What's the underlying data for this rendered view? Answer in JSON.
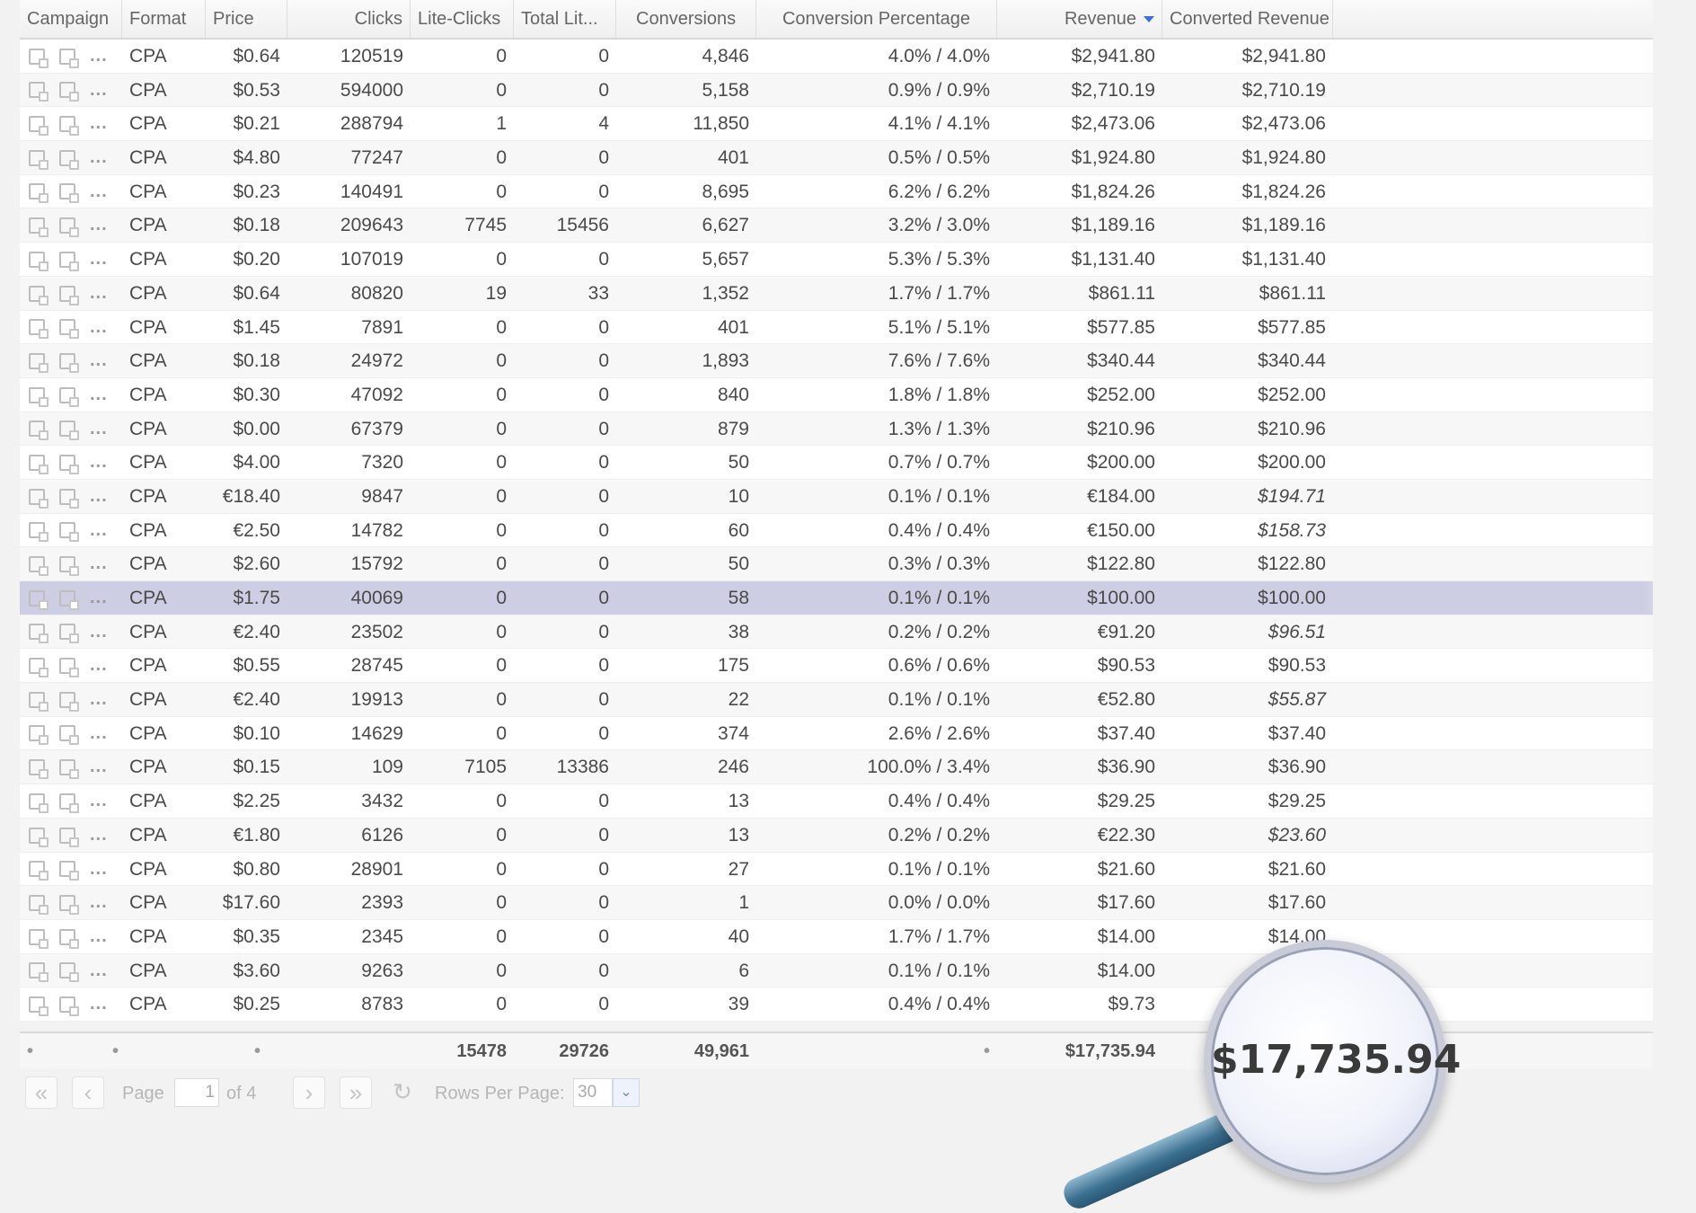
{
  "columns": {
    "campaign": "Campaign",
    "format": "Format",
    "price": "Price",
    "clicks": "Clicks",
    "lite_clicks": "Lite-Clicks",
    "total_lite": "Total Lit...",
    "conversions": "Conversions",
    "conversion_percentage": "Conversion Percentage",
    "revenue": "Revenue",
    "converted_revenue": "Converted Revenue"
  },
  "sort": {
    "column": "revenue",
    "direction": "desc",
    "indicator_color": "#3a6fd6"
  },
  "row_icons": [
    "copy-icon",
    "window-icon",
    "more-icon"
  ],
  "more_glyph": "...",
  "rows": [
    {
      "format": "CPA",
      "price": "$0.64",
      "clicks": "120519",
      "lite": "0",
      "total_lite": "0",
      "conv": "4,846",
      "pct": "4.0% / 4.0%",
      "revenue": "$2,941.80",
      "converted": "$2,941.80"
    },
    {
      "format": "CPA",
      "price": "$0.53",
      "clicks": "594000",
      "lite": "0",
      "total_lite": "0",
      "conv": "5,158",
      "pct": "0.9% / 0.9%",
      "revenue": "$2,710.19",
      "converted": "$2,710.19"
    },
    {
      "format": "CPA",
      "price": "$0.21",
      "clicks": "288794",
      "lite": "1",
      "total_lite": "4",
      "conv": "11,850",
      "pct": "4.1% / 4.1%",
      "revenue": "$2,473.06",
      "converted": "$2,473.06"
    },
    {
      "format": "CPA",
      "price": "$4.80",
      "clicks": "77247",
      "lite": "0",
      "total_lite": "0",
      "conv": "401",
      "pct": "0.5% / 0.5%",
      "revenue": "$1,924.80",
      "converted": "$1,924.80"
    },
    {
      "format": "CPA",
      "price": "$0.23",
      "clicks": "140491",
      "lite": "0",
      "total_lite": "0",
      "conv": "8,695",
      "pct": "6.2% / 6.2%",
      "revenue": "$1,824.26",
      "converted": "$1,824.26"
    },
    {
      "format": "CPA",
      "price": "$0.18",
      "clicks": "209643",
      "lite": "7745",
      "total_lite": "15456",
      "conv": "6,627",
      "pct": "3.2% / 3.0%",
      "revenue": "$1,189.16",
      "converted": "$1,189.16"
    },
    {
      "format": "CPA",
      "price": "$0.20",
      "clicks": "107019",
      "lite": "0",
      "total_lite": "0",
      "conv": "5,657",
      "pct": "5.3% / 5.3%",
      "revenue": "$1,131.40",
      "converted": "$1,131.40"
    },
    {
      "format": "CPA",
      "price": "$0.64",
      "clicks": "80820",
      "lite": "19",
      "total_lite": "33",
      "conv": "1,352",
      "pct": "1.7% / 1.7%",
      "revenue": "$861.11",
      "converted": "$861.11"
    },
    {
      "format": "CPA",
      "price": "$1.45",
      "clicks": "7891",
      "lite": "0",
      "total_lite": "0",
      "conv": "401",
      "pct": "5.1% / 5.1%",
      "revenue": "$577.85",
      "converted": "$577.85"
    },
    {
      "format": "CPA",
      "price": "$0.18",
      "clicks": "24972",
      "lite": "0",
      "total_lite": "0",
      "conv": "1,893",
      "pct": "7.6% / 7.6%",
      "revenue": "$340.44",
      "converted": "$340.44"
    },
    {
      "format": "CPA",
      "price": "$0.30",
      "clicks": "47092",
      "lite": "0",
      "total_lite": "0",
      "conv": "840",
      "pct": "1.8% / 1.8%",
      "revenue": "$252.00",
      "converted": "$252.00"
    },
    {
      "format": "CPA",
      "price": "$0.00",
      "clicks": "67379",
      "lite": "0",
      "total_lite": "0",
      "conv": "879",
      "pct": "1.3% / 1.3%",
      "revenue": "$210.96",
      "converted": "$210.96"
    },
    {
      "format": "CPA",
      "price": "$4.00",
      "clicks": "7320",
      "lite": "0",
      "total_lite": "0",
      "conv": "50",
      "pct": "0.7% / 0.7%",
      "revenue": "$200.00",
      "converted": "$200.00"
    },
    {
      "format": "CPA",
      "price": "€18.40",
      "clicks": "9847",
      "lite": "0",
      "total_lite": "0",
      "conv": "10",
      "pct": "0.1% / 0.1%",
      "revenue": "€184.00",
      "converted": "$194.71",
      "converted_italic": true
    },
    {
      "format": "CPA",
      "price": "€2.50",
      "clicks": "14782",
      "lite": "0",
      "total_lite": "0",
      "conv": "60",
      "pct": "0.4% / 0.4%",
      "revenue": "€150.00",
      "converted": "$158.73",
      "converted_italic": true
    },
    {
      "format": "CPA",
      "price": "$2.60",
      "clicks": "15792",
      "lite": "0",
      "total_lite": "0",
      "conv": "50",
      "pct": "0.3% / 0.3%",
      "revenue": "$122.80",
      "converted": "$122.80"
    },
    {
      "format": "CPA",
      "price": "$1.75",
      "clicks": "40069",
      "lite": "0",
      "total_lite": "0",
      "conv": "58",
      "pct": "0.1% / 0.1%",
      "revenue": "$100.00",
      "converted": "$100.00",
      "selected": true
    },
    {
      "format": "CPA",
      "price": "€2.40",
      "clicks": "23502",
      "lite": "0",
      "total_lite": "0",
      "conv": "38",
      "pct": "0.2% / 0.2%",
      "revenue": "€91.20",
      "converted": "$96.51",
      "converted_italic": true
    },
    {
      "format": "CPA",
      "price": "$0.55",
      "clicks": "28745",
      "lite": "0",
      "total_lite": "0",
      "conv": "175",
      "pct": "0.6% / 0.6%",
      "revenue": "$90.53",
      "converted": "$90.53"
    },
    {
      "format": "CPA",
      "price": "€2.40",
      "clicks": "19913",
      "lite": "0",
      "total_lite": "0",
      "conv": "22",
      "pct": "0.1% / 0.1%",
      "revenue": "€52.80",
      "converted": "$55.87",
      "converted_italic": true
    },
    {
      "format": "CPA",
      "price": "$0.10",
      "clicks": "14629",
      "lite": "0",
      "total_lite": "0",
      "conv": "374",
      "pct": "2.6% / 2.6%",
      "revenue": "$37.40",
      "converted": "$37.40"
    },
    {
      "format": "CPA",
      "price": "$0.15",
      "clicks": "109",
      "lite": "7105",
      "total_lite": "13386",
      "conv": "246",
      "pct": "100.0% / 3.4%",
      "revenue": "$36.90",
      "converted": "$36.90"
    },
    {
      "format": "CPA",
      "price": "$2.25",
      "clicks": "3432",
      "lite": "0",
      "total_lite": "0",
      "conv": "13",
      "pct": "0.4% / 0.4%",
      "revenue": "$29.25",
      "converted": "$29.25"
    },
    {
      "format": "CPA",
      "price": "€1.80",
      "clicks": "6126",
      "lite": "0",
      "total_lite": "0",
      "conv": "13",
      "pct": "0.2% / 0.2%",
      "revenue": "€22.30",
      "converted": "$23.60",
      "converted_italic": true
    },
    {
      "format": "CPA",
      "price": "$0.80",
      "clicks": "28901",
      "lite": "0",
      "total_lite": "0",
      "conv": "27",
      "pct": "0.1% / 0.1%",
      "revenue": "$21.60",
      "converted": "$21.60"
    },
    {
      "format": "CPA",
      "price": "$17.60",
      "clicks": "2393",
      "lite": "0",
      "total_lite": "0",
      "conv": "1",
      "pct": "0.0% / 0.0%",
      "revenue": "$17.60",
      "converted": "$17.60"
    },
    {
      "format": "CPA",
      "price": "$0.35",
      "clicks": "2345",
      "lite": "0",
      "total_lite": "0",
      "conv": "40",
      "pct": "1.7% / 1.7%",
      "revenue": "$14.00",
      "converted": "$14.00"
    },
    {
      "format": "CPA",
      "price": "$3.60",
      "clicks": "9263",
      "lite": "0",
      "total_lite": "0",
      "conv": "6",
      "pct": "0.1% / 0.1%",
      "revenue": "$14.00",
      "converted": "$14.00"
    },
    {
      "format": "CPA",
      "price": "$0.25",
      "clicks": "8783",
      "lite": "0",
      "total_lite": "0",
      "conv": "39",
      "pct": "0.4% / 0.4%",
      "revenue": "$9.73",
      "converted": "$9.73"
    }
  ],
  "totals": {
    "campaign": "•",
    "format": "•",
    "price": "•",
    "lite_clicks": "15478",
    "total_lite": "29726",
    "conversions": "49,961",
    "conversion_percentage": "•",
    "revenue": "$17,735.94",
    "converted_revenue": "$17,735.94"
  },
  "pager": {
    "first_glyph": "«",
    "prev_glyph": "‹",
    "next_glyph": "›",
    "last_glyph": "»",
    "refresh_glyph": "↻",
    "page_label": "Page",
    "page_value": "1",
    "of_label": "of 4",
    "rows_per_page_label": "Rows Per Page:",
    "rows_per_page_value": "30",
    "dropdown_glyph": "⌄"
  },
  "magnifier": {
    "text": "$17,735.94"
  }
}
